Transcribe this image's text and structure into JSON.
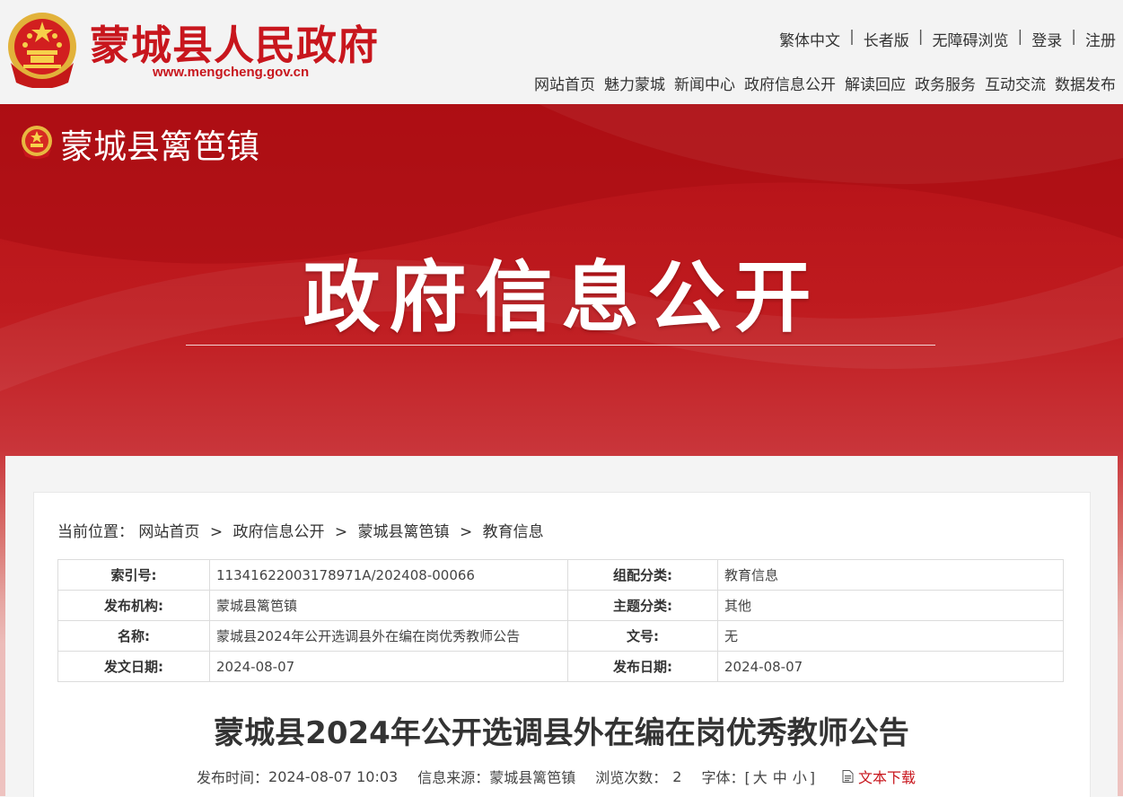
{
  "header": {
    "site_name": "蒙城县人民政府",
    "domain": "www.mengcheng.gov.cn",
    "util_links": [
      "繁体中文",
      "长者版",
      "无障碍浏览",
      "登录",
      "注册"
    ],
    "separator": "|",
    "nav": [
      "网站首页",
      "魅力蒙城",
      "新闻中心",
      "政府信息公开",
      "解读回应",
      "政务服务",
      "互动交流",
      "数据发布"
    ]
  },
  "banner": {
    "town_name": "蒙城县篱笆镇",
    "title": "政府信息公开"
  },
  "breadcrumb": {
    "prefix": "当前位置：",
    "items": [
      "网站首页",
      "政府信息公开",
      "蒙城县篱笆镇",
      "教育信息"
    ],
    "sep": ">"
  },
  "meta_table": [
    {
      "k1": "索引号:",
      "v1": "11341622003178971A/202408-00066",
      "k2": "组配分类:",
      "v2": "教育信息"
    },
    {
      "k1": "发布机构:",
      "v1": "蒙城县篱笆镇",
      "k2": "主题分类:",
      "v2": "其他"
    },
    {
      "k1": "名称:",
      "v1": "蒙城县2024年公开选调县外在编在岗优秀教师公告",
      "k2": "文号:",
      "v2": "无"
    },
    {
      "k1": "发文日期:",
      "v1": "2024-08-07",
      "k2": "发布日期:",
      "v2": "2024-08-07"
    }
  ],
  "article": {
    "title": "蒙城县2024年公开选调县外在编在岗优秀教师公告",
    "publish_label": "发布时间：",
    "publish_time": "2024-08-07 10:03",
    "source_label": "信息来源：",
    "source": "蒙城县篱笆镇",
    "views_label": "浏览次数：",
    "views": "2",
    "font_label": "字体：",
    "font_open": "[",
    "font_sizes": [
      "大",
      "中",
      "小"
    ],
    "font_close": "]",
    "download_label": "文本下载"
  },
  "colors": {
    "brand_red": "#c8161d",
    "banner_red": "#b41016",
    "page_bg": "#f3f3f3"
  },
  "icons": {
    "national_emblem": "national-emblem-icon",
    "download": "document-download-icon"
  }
}
